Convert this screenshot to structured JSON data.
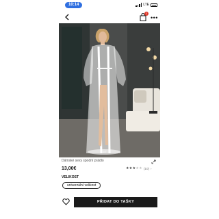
{
  "status": {
    "time": "10:14",
    "network": "LTE"
  },
  "nav": {
    "cart_count": "1"
  },
  "image": {
    "carousel_indicator": "1/7"
  },
  "product": {
    "title": "Dámské sexy spodní prádlo",
    "price": "13,00€",
    "rating": {
      "stars": 3.5,
      "count": "(10)",
      "arrow": "›"
    }
  },
  "size": {
    "label": "VELIKOST",
    "option": "univerzální velikost"
  },
  "actions": {
    "add_to_bag": "PŘIDAT DO TAŠKY"
  },
  "colors": {
    "accent": "#1a1a1a",
    "time_pill": "#2f6fe0",
    "badge": "#e0392b"
  },
  "icons": [
    "back-icon",
    "shopping-bag-icon",
    "more-icon",
    "expand-icon",
    "star-icon",
    "heart-icon"
  ]
}
